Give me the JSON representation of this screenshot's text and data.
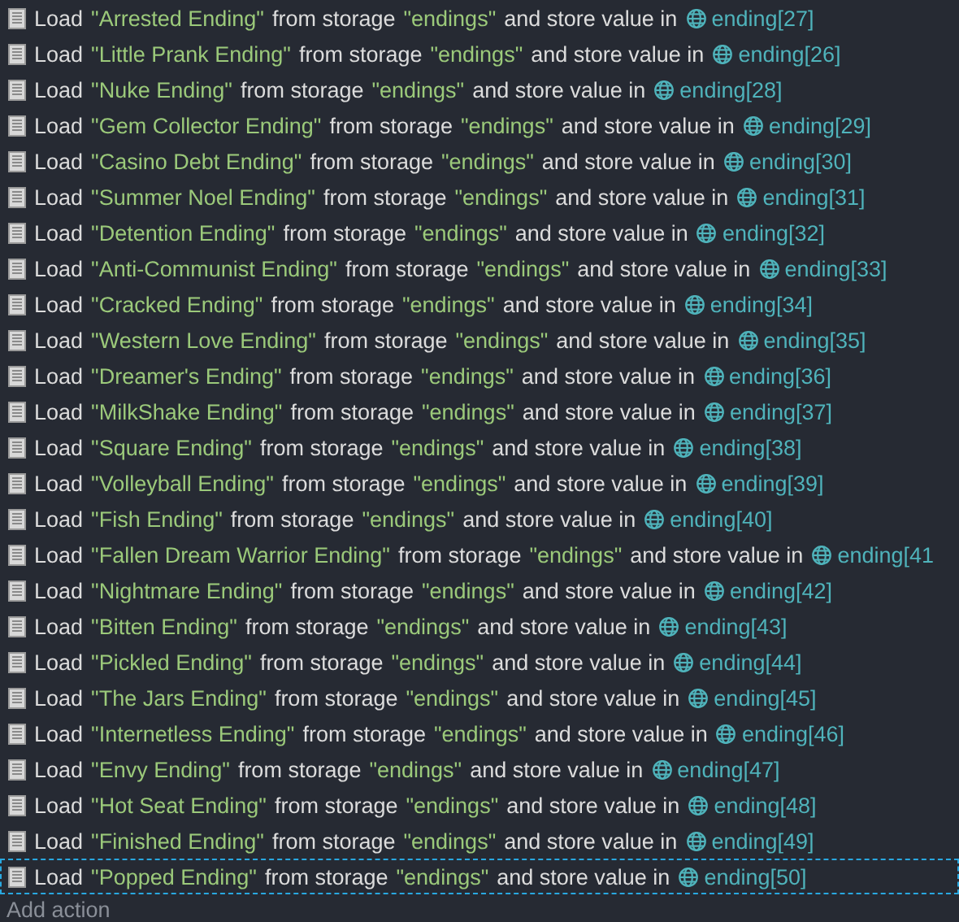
{
  "actions": [
    {
      "verb": "Load",
      "name": "\"Arrested Ending\"",
      "from": "from storage",
      "storage": "\"endings\"",
      "store": "and store value in",
      "variable": "ending[27]",
      "selected": false
    },
    {
      "verb": "Load",
      "name": "\"Little Prank Ending\"",
      "from": "from storage",
      "storage": "\"endings\"",
      "store": "and store value in",
      "variable": "ending[26]",
      "selected": false
    },
    {
      "verb": "Load",
      "name": "\"Nuke Ending\"",
      "from": "from storage",
      "storage": "\"endings\"",
      "store": "and store value in",
      "variable": "ending[28]",
      "selected": false
    },
    {
      "verb": "Load",
      "name": "\"Gem Collector Ending\"",
      "from": "from storage",
      "storage": "\"endings\"",
      "store": "and store value in",
      "variable": "ending[29]",
      "selected": false
    },
    {
      "verb": "Load",
      "name": "\"Casino Debt Ending\"",
      "from": "from storage",
      "storage": "\"endings\"",
      "store": "and store value in",
      "variable": "ending[30]",
      "selected": false
    },
    {
      "verb": "Load",
      "name": "\"Summer Noel Ending\"",
      "from": "from storage",
      "storage": "\"endings\"",
      "store": "and store value in",
      "variable": "ending[31]",
      "selected": false
    },
    {
      "verb": "Load",
      "name": "\"Detention Ending\"",
      "from": "from storage",
      "storage": "\"endings\"",
      "store": "and store value in",
      "variable": "ending[32]",
      "selected": false
    },
    {
      "verb": "Load",
      "name": "\"Anti-Communist Ending\"",
      "from": "from storage",
      "storage": "\"endings\"",
      "store": "and store value in",
      "variable": "ending[33]",
      "selected": false
    },
    {
      "verb": "Load",
      "name": "\"Cracked Ending\"",
      "from": "from storage",
      "storage": "\"endings\"",
      "store": "and store value in",
      "variable": "ending[34]",
      "selected": false
    },
    {
      "verb": "Load",
      "name": "\"Western Love Ending\"",
      "from": "from storage",
      "storage": "\"endings\"",
      "store": "and store value in",
      "variable": "ending[35]",
      "selected": false
    },
    {
      "verb": "Load",
      "name": "\"Dreamer's Ending\"",
      "from": "from storage",
      "storage": "\"endings\"",
      "store": "and store value in",
      "variable": "ending[36]",
      "selected": false
    },
    {
      "verb": "Load",
      "name": "\"MilkShake Ending\"",
      "from": "from storage",
      "storage": "\"endings\"",
      "store": "and store value in",
      "variable": "ending[37]",
      "selected": false
    },
    {
      "verb": "Load",
      "name": "\"Square Ending\"",
      "from": "from storage",
      "storage": "\"endings\"",
      "store": "and store value in",
      "variable": "ending[38]",
      "selected": false
    },
    {
      "verb": "Load",
      "name": "\"Volleyball Ending\"",
      "from": "from storage",
      "storage": "\"endings\"",
      "store": "and store value in",
      "variable": "ending[39]",
      "selected": false
    },
    {
      "verb": "Load",
      "name": "\"Fish Ending\"",
      "from": "from storage",
      "storage": "\"endings\"",
      "store": "and store value in",
      "variable": "ending[40]",
      "selected": false
    },
    {
      "verb": "Load",
      "name": "\"Fallen Dream Warrior Ending\"",
      "from": "from storage",
      "storage": "\"endings\"",
      "store": "and store value in",
      "variable": "ending[41",
      "selected": false
    },
    {
      "verb": "Load",
      "name": "\"Nightmare Ending\"",
      "from": "from storage",
      "storage": "\"endings\"",
      "store": "and store value in",
      "variable": "ending[42]",
      "selected": false
    },
    {
      "verb": "Load",
      "name": "\"Bitten Ending\"",
      "from": "from storage",
      "storage": "\"endings\"",
      "store": "and store value in",
      "variable": "ending[43]",
      "selected": false
    },
    {
      "verb": "Load",
      "name": "\"Pickled Ending\"",
      "from": "from storage",
      "storage": "\"endings\"",
      "store": "and store value in",
      "variable": "ending[44]",
      "selected": false
    },
    {
      "verb": "Load",
      "name": "\"The Jars Ending\"",
      "from": "from storage",
      "storage": "\"endings\"",
      "store": "and store value in",
      "variable": "ending[45]",
      "selected": false
    },
    {
      "verb": "Load",
      "name": "\"Internetless Ending\"",
      "from": "from storage",
      "storage": "\"endings\"",
      "store": "and store value in",
      "variable": "ending[46]",
      "selected": false
    },
    {
      "verb": "Load",
      "name": "\"Envy Ending\"",
      "from": "from storage",
      "storage": "\"endings\"",
      "store": "and store value in",
      "variable": "ending[47]",
      "selected": false
    },
    {
      "verb": "Load",
      "name": "\"Hot Seat Ending\"",
      "from": "from storage",
      "storage": "\"endings\"",
      "store": "and store value in",
      "variable": "ending[48]",
      "selected": false
    },
    {
      "verb": "Load",
      "name": "\"Finished Ending\"",
      "from": "from storage",
      "storage": "\"endings\"",
      "store": "and store value in",
      "variable": "ending[49]",
      "selected": false
    },
    {
      "verb": "Load",
      "name": "\"Popped Ending\"",
      "from": "from storage",
      "storage": "\"endings\"",
      "store": "and store value in",
      "variable": "ending[50]",
      "selected": true
    }
  ],
  "add_action": "Add action"
}
